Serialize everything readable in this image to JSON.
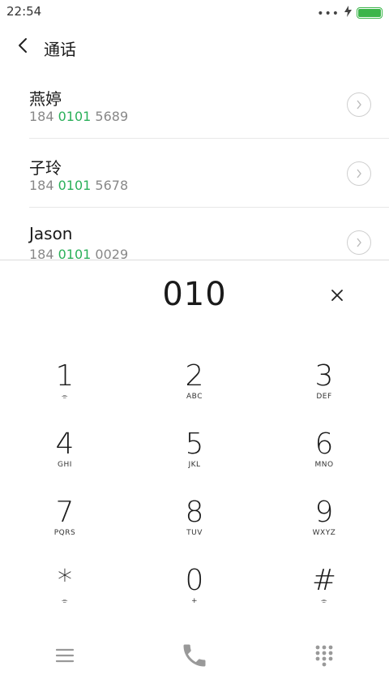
{
  "status": {
    "time": "22:54",
    "dots": "•••",
    "charging_icon": "bolt-icon",
    "battery_level": 1.0,
    "battery_color": "#3bb54a"
  },
  "header": {
    "title": "通话",
    "back_icon": "chevron-left-icon"
  },
  "contacts": [
    {
      "name": "燕婷",
      "number_pre": "184 ",
      "number_match": "0101",
      "number_post": " 5689"
    },
    {
      "name": "子玲",
      "number_pre": "184 ",
      "number_match": "0101",
      "number_post": " 5678"
    },
    {
      "name": "Jason",
      "number_pre": "184 ",
      "number_match": "0101",
      "number_post": " 0029"
    }
  ],
  "dialer": {
    "input": "010",
    "clear_icon": "close-icon"
  },
  "keys": [
    {
      "digit": "1",
      "letters": "⌯"
    },
    {
      "digit": "2",
      "letters": "ABC"
    },
    {
      "digit": "3",
      "letters": "DEF"
    },
    {
      "digit": "4",
      "letters": "GHI"
    },
    {
      "digit": "5",
      "letters": "JKL"
    },
    {
      "digit": "6",
      "letters": "MNO"
    },
    {
      "digit": "7",
      "letters": "PQRS"
    },
    {
      "digit": "8",
      "letters": "TUV"
    },
    {
      "digit": "9",
      "letters": "WXYZ"
    },
    {
      "digit": "*",
      "letters": "⌯"
    },
    {
      "digit": "0",
      "letters": "+"
    },
    {
      "digit": "#",
      "letters": "⌯"
    }
  ],
  "bottom": {
    "menu_icon": "menu-icon",
    "call_icon": "phone-icon",
    "keypad_icon": "dialpad-icon"
  },
  "colors": {
    "accent": "#2bb05a",
    "icon_gray": "#999999"
  }
}
